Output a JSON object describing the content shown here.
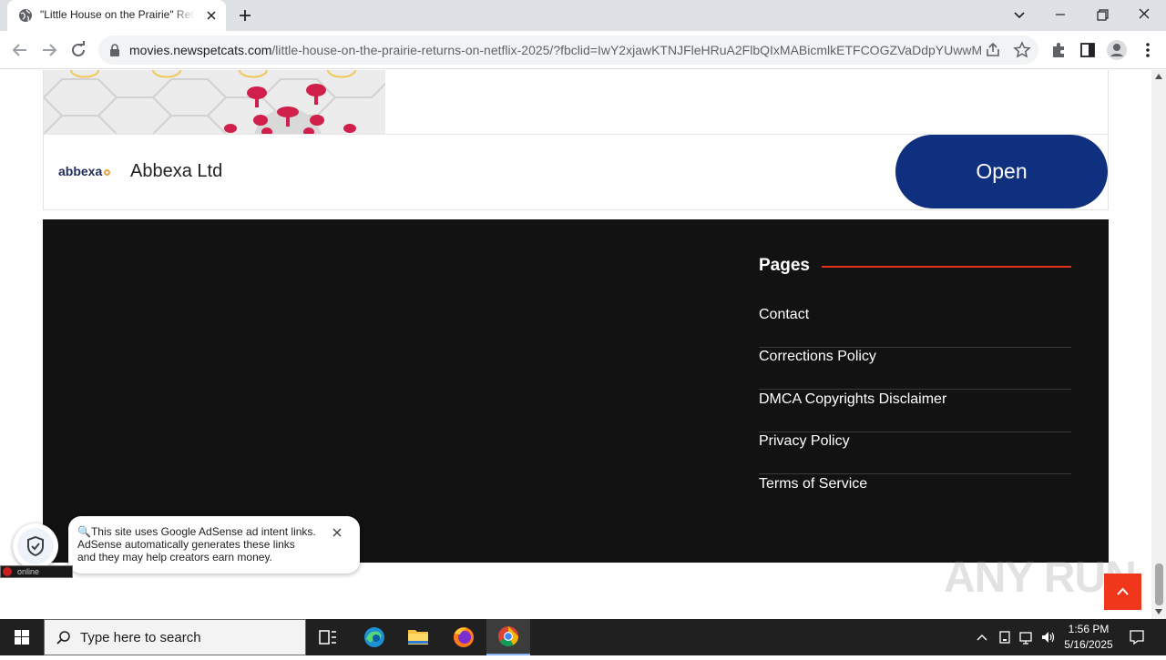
{
  "browser": {
    "tab_title": "\"Little House on the Prairie\" Retu",
    "url_host": "movies.newspetcats.com",
    "url_path": "/little-house-on-the-prairie-returns-on-netflix-2025/?fbclid=IwY2xjawKTNJFleHRuA2FlbQIxMABicmlkETFCOGZVaDdpYUwwM..."
  },
  "ad": {
    "logo_text": "abbexa",
    "advertiser": "Abbexa Ltd",
    "cta_label": "Open",
    "cta_color": "#0f2f7f"
  },
  "footer": {
    "section_title": "Pages",
    "accent_color": "#e5321b",
    "links": [
      "Contact",
      "Corrections Policy",
      "DMCA Copyrights Disclaimer",
      "Privacy Policy",
      "Terms of Service"
    ]
  },
  "adsense_notice": {
    "line1": "This site uses Google AdSense ad intent links.",
    "line2": "AdSense automatically generates these links",
    "line3": "and they may help creators earn money."
  },
  "mini_bar_text": "online",
  "watermark": "ANY RUN",
  "taskbar": {
    "search_placeholder": "Type here to search",
    "time": "1:56 PM",
    "date": "5/16/2025",
    "apps": [
      "task-view-icon",
      "edge-icon",
      "file-explorer-icon",
      "firefox-icon",
      "chrome-icon"
    ]
  }
}
